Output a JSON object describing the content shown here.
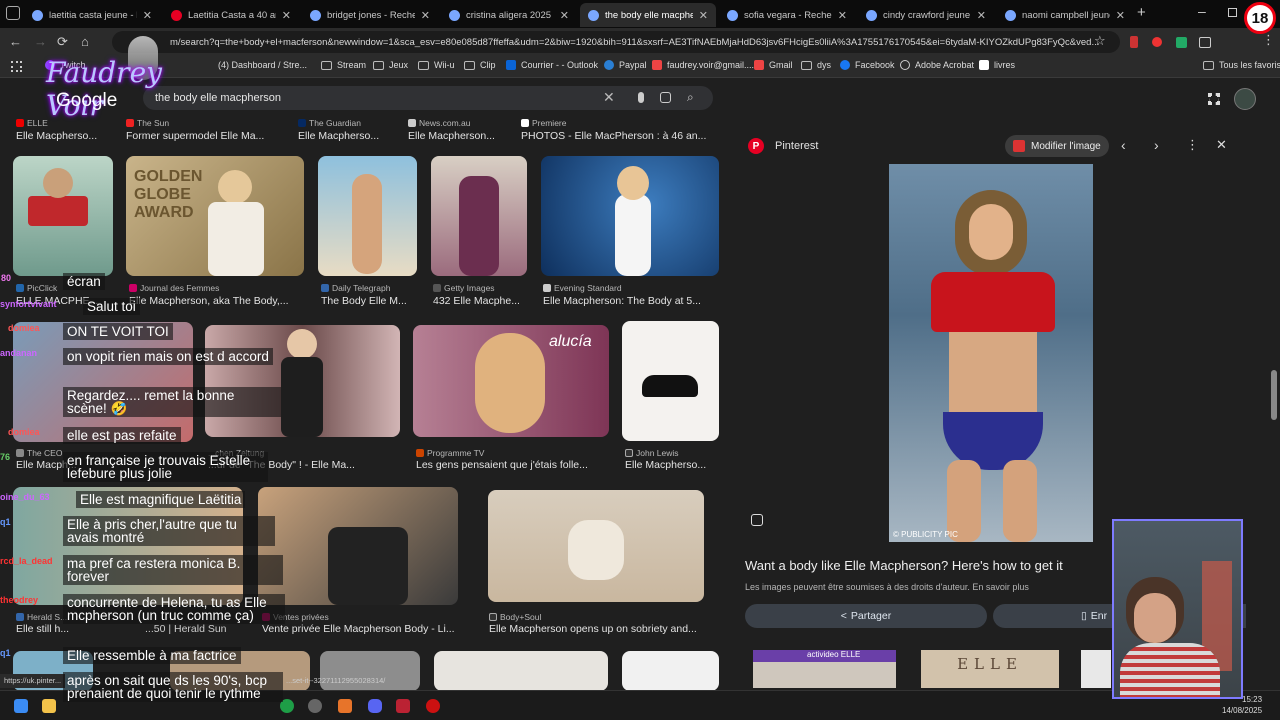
{
  "tabs": [
    {
      "title": "laetitia casta jeune - Rech",
      "color": "#7aa7ff",
      "active": false
    },
    {
      "title": "Laetitia Casta a 40 ans :",
      "color": "#e60023",
      "active": false
    },
    {
      "title": "bridget jones - Recherche",
      "color": "#7aa7ff",
      "active": false
    },
    {
      "title": "cristina aligera 2025 - Rec",
      "color": "#7aa7ff",
      "active": false
    },
    {
      "title": "the body elle macpherson",
      "color": "#7aa7ff",
      "active": true
    },
    {
      "title": "sofia vegara - Recherche",
      "color": "#7aa7ff",
      "active": false
    },
    {
      "title": "cindy crawford jeune - Re",
      "color": "#7aa7ff",
      "active": false
    },
    {
      "title": "naomi campbell jeune - R",
      "color": "#7aa7ff",
      "active": false
    }
  ],
  "url": "m/search?q=the+body+el+macferson&newwindow=1&sca_esv=e80e085d87ffeffa&udm=2&biw=1920&bih=911&sxsrf=AE3TifNAEbMjaHdD63jsv6FHcigEs0liiA%3A1755176170545&ei=6tydaM-KIYOZkdUPg83FyQc&ved...",
  "bookmarks": [
    "Twitch",
    "(4) Dashboard / Stre...",
    "Stream",
    "Jeux",
    "Wii-u",
    "Clip",
    "Courrier - - Outlook",
    "Paypal",
    "faudrey.voir@gmail....",
    "Gmail",
    "dys",
    "Facebook",
    "Adobe Acrobat",
    "livres",
    "Tous les favoris"
  ],
  "overlay": {
    "brand": "Faudrey Voir",
    "age": "18"
  },
  "google": {
    "logo": "Google",
    "query": "the body elle macpherson"
  },
  "results": {
    "row0": [
      {
        "src": "ELLE",
        "title": "Elle Macpherso..."
      },
      {
        "src": "The Sun",
        "title": "Former supermodel Elle Ma..."
      },
      {
        "src": "The Guardian",
        "title": "Elle Macpherso..."
      },
      {
        "src": "News.com.au",
        "title": "Elle Macpherson..."
      },
      {
        "src": "Premiere",
        "title": "PHOTOS - Elle MacPherson : à 46 an..."
      }
    ],
    "row1": [
      {
        "src": "PicClick",
        "title": "ELLE MACPHE..."
      },
      {
        "src": "Journal des Femmes",
        "title": "Elle Macpherson, aka The Body,..."
      },
      {
        "src": "Daily Telegraph",
        "title": "The Body Elle M..."
      },
      {
        "src": "Getty Images",
        "title": "432 Elle Macphe..."
      },
      {
        "src": "Evening Standard",
        "title": "Elle Macpherson: The Body at 5..."
      }
    ],
    "row2": [
      {
        "src": "The CEO",
        "title": "Elle Macph..."
      },
      {
        "src": "...chen Zeitung",
        "title": "...ur de \"The Body\" ! - Elle Ma..."
      },
      {
        "src": "Programme TV",
        "title": "Les gens pensaient que j'étais folle..."
      },
      {
        "src": "John Lewis",
        "title": "Elle Macpherso..."
      }
    ],
    "row3": [
      {
        "src": "Herald S...",
        "title": "Elle still h..."
      },
      {
        "src": "Ventes privées",
        "title": "Vente privée Elle Macpherson Body - Li..."
      },
      {
        "src": "Body+Soul",
        "title": "Elle Macpherson opens up on sobriety and..."
      }
    ],
    "partials": {
      "row3_herald": "...50 | Herald Sun",
      "status_url": "https://uk.pinter...",
      "status_tail": "...set-it--32271112955028314/"
    }
  },
  "panel": {
    "source": "Pinterest",
    "modify": "Modifier l'image",
    "credit": "© PUBLICITY PIC",
    "title": "Want a body like Elle Macpherson? Here's how to get it",
    "notice": "Les images peuvent être soumises à des droits d'auteur.",
    "learn": "En savoir plus",
    "share": "Partager",
    "save": "Enr",
    "thumb1": "activideo ELLE",
    "thumb2": "ELLE"
  },
  "chat": {
    "messages": [
      "écran",
      "Salut toi",
      "ON TE VOIT TOI",
      "on vopit rien mais on est d accord",
      "Regardez.... remet la bonne scène! 🤣",
      "elle est pas refaite",
      "en française je trouvais Estelle lefebure plus jolie",
      "Elle est magnifique Laëtitia",
      "Elle à pris cher,l'autre que tu avais montré",
      "ma pref ca restera monica B. forever",
      "concurrente de Helena, tu as Elle mcpherson (un truc comme ça)",
      "Elle ressemble à ma factrice",
      "après on sait que ds les 90's, bcp prenaient de quoi tenir le rythme"
    ],
    "users": [
      "80",
      "synfortvivant",
      "domiea",
      "andanan",
      "...",
      "domiea",
      "76",
      "oine_du_63",
      "q1",
      "rcd_la_dead",
      "theodrey",
      "q1"
    ]
  },
  "clock": {
    "time": "15:23",
    "date": "14/08/2025"
  }
}
